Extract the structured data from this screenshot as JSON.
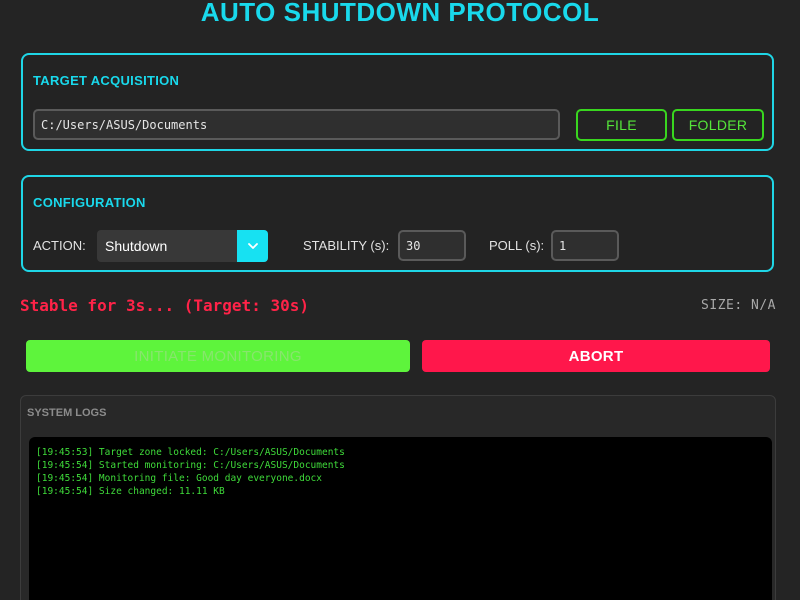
{
  "app": {
    "title": "AUTO SHUTDOWN PROTOCOL"
  },
  "target": {
    "section_title": "TARGET ACQUISITION",
    "path_value": "C:/Users/ASUS/Documents",
    "file_label": "FILE",
    "folder_label": "FOLDER"
  },
  "config": {
    "section_title": "CONFIGURATION",
    "action_label": "ACTION:",
    "action_value": "Shutdown",
    "stability_label": "STABILITY (s):",
    "stability_value": "30",
    "poll_label": "POLL (s):",
    "poll_value": "1"
  },
  "status": {
    "text": "Stable for 3s... (Target: 30s)",
    "size": "SIZE: N/A"
  },
  "actions": {
    "initiate_label": "INITIATE MONITORING",
    "abort_label": "ABORT"
  },
  "logs": {
    "title": "SYSTEM LOGS",
    "lines": [
      "[19:45:53] Target zone locked: C:/Users/ASUS/Documents",
      "[19:45:54] Started monitoring: C:/Users/ASUS/Documents",
      "[19:45:54] Monitoring file: Good day everyone.docx",
      "[19:45:54] Size changed: 11.11 KB"
    ]
  },
  "colors": {
    "accent_cyan": "#19d9ec",
    "accent_green": "#39d61f",
    "danger_red": "#ff174b",
    "log_green": "#3fdb3a",
    "background": "#242424"
  },
  "icons": {
    "dropdown": "chevron-down-icon"
  }
}
